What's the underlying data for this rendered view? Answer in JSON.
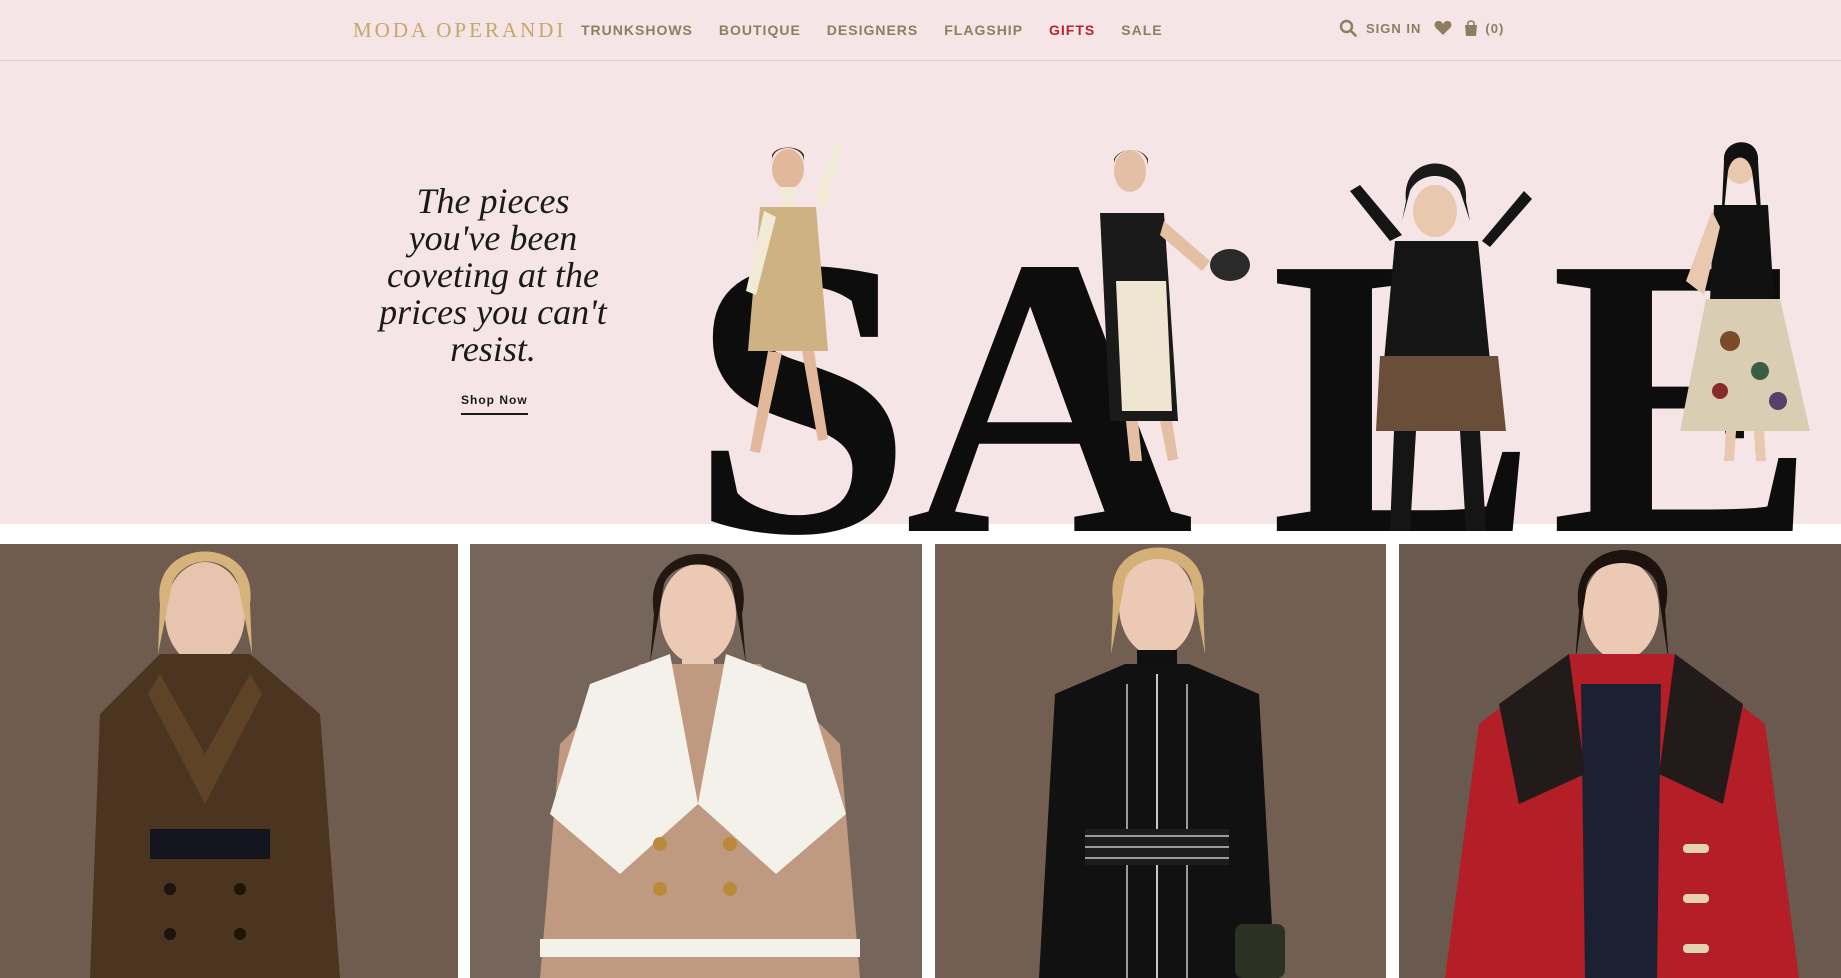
{
  "header": {
    "logo": "MODA OPERANDI",
    "nav": [
      {
        "label": "TRUNKSHOWS"
      },
      {
        "label": "BOUTIQUE"
      },
      {
        "label": "DESIGNERS"
      },
      {
        "label": "FLAGSHIP"
      },
      {
        "label": "GIFTS"
      },
      {
        "label": "SALE"
      }
    ],
    "sign_in": "SIGN IN",
    "bag_count": "(0)",
    "icons": [
      "search-icon",
      "heart-icon",
      "shopping-bag-icon"
    ]
  },
  "hero": {
    "tagline": "The pieces you've been coveting at the prices you can't resist.",
    "cta": "Shop Now",
    "art_letters": [
      "S",
      "A",
      "L",
      "E"
    ]
  },
  "tiles": [
    {
      "description": "brown suede trench coat"
    },
    {
      "description": "shearling jacket"
    },
    {
      "description": "black knit dress"
    },
    {
      "description": "red duffle coat"
    }
  ],
  "colors": {
    "header_bg": "#f5e5e6",
    "logo_gold": "#c4a76a",
    "nav_text": "#8f7d60",
    "accent_red": "#b3272b",
    "tile_bg": "#6e5b4f"
  }
}
